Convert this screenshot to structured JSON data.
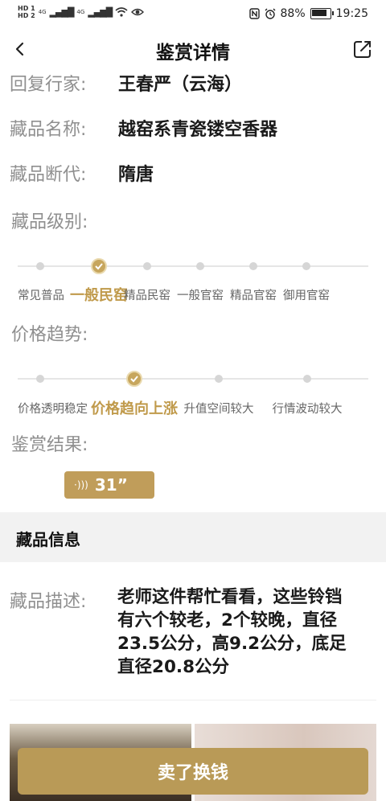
{
  "status": {
    "hd1": "HD 1",
    "hd2": "HD 2",
    "net1": "4G",
    "net2": "4G",
    "battery_pct": "88%",
    "time": "19:25",
    "battery_level": 0.88
  },
  "header": {
    "title": "鉴赏详情"
  },
  "fields": {
    "appraiser_label": "回复行家:",
    "appraiser_value": "王春严（云海）",
    "name_label": "藏品名称:",
    "name_value": "越窑系青瓷镂空香器",
    "dynasty_label": "藏品断代:",
    "dynasty_value": "隋唐",
    "grade_label": "藏品级别:",
    "trend_label": "价格趋势:",
    "result_label": "鉴赏结果:"
  },
  "grade_options": [
    "常见普品",
    "一般民窑",
    "精品民窑",
    "一般官窑",
    "精品官窑",
    "御用官窑"
  ],
  "grade_selected": 1,
  "trend_options": [
    "价格透明稳定",
    "价格趋向上涨",
    "升值空间较大",
    "行情波动较大"
  ],
  "trend_selected": 1,
  "voice": {
    "duration": "31”"
  },
  "info": {
    "section_title": "藏品信息",
    "desc_label": "藏品描述:",
    "desc_value": "老师这件帮忙看看，这些铃铛有六个较老，2个较晚，直径23.5公分，高9.2公分，底足直径20.8公分"
  },
  "footer": {
    "sell_label": "卖了换钱"
  },
  "colors": {
    "accent": "#c09a4b",
    "button": "#b99a57",
    "label": "#8f8f8f"
  }
}
